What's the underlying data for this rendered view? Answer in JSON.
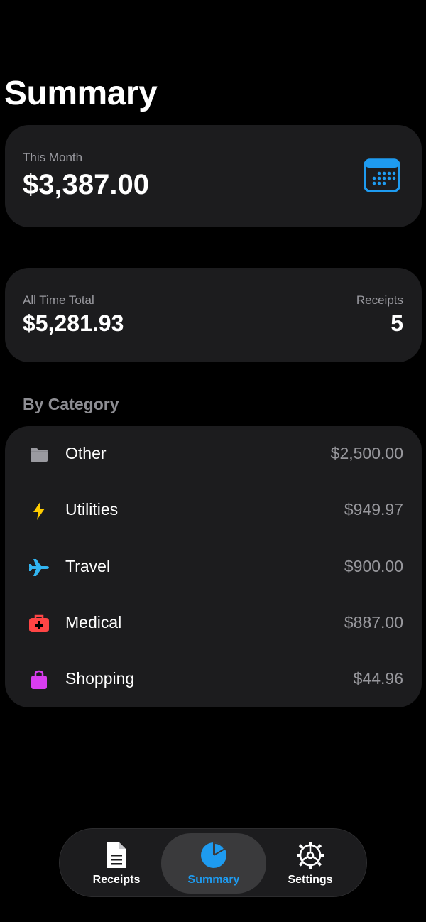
{
  "header": {
    "title": "Summary"
  },
  "this_month": {
    "label": "This Month",
    "value": "$3,387.00",
    "icon": "calendar-icon",
    "accent": "#1e9bf0"
  },
  "totals": {
    "all_time_label": "All Time Total",
    "all_time_value": "$5,281.93",
    "receipts_label": "Receipts",
    "receipts_value": "5"
  },
  "categories": {
    "heading": "By Category",
    "items": [
      {
        "name": "Other",
        "amount": "$2,500.00",
        "icon": "folder-icon",
        "color": "#9a9aa0"
      },
      {
        "name": "Utilities",
        "amount": "$949.97",
        "icon": "bolt-icon",
        "color": "#ffcc00"
      },
      {
        "name": "Travel",
        "amount": "$900.00",
        "icon": "airplane-icon",
        "color": "#32b4f0"
      },
      {
        "name": "Medical",
        "amount": "$887.00",
        "icon": "medical-kit-icon",
        "color": "#ff4545"
      },
      {
        "name": "Shopping",
        "amount": "$44.96",
        "icon": "shopping-bag-icon",
        "color": "#d93df0"
      }
    ]
  },
  "tabs": [
    {
      "label": "Receipts",
      "icon": "document-icon",
      "active": false
    },
    {
      "label": "Summary",
      "icon": "pie-chart-icon",
      "active": true
    },
    {
      "label": "Settings",
      "icon": "gear-icon",
      "active": false
    }
  ]
}
